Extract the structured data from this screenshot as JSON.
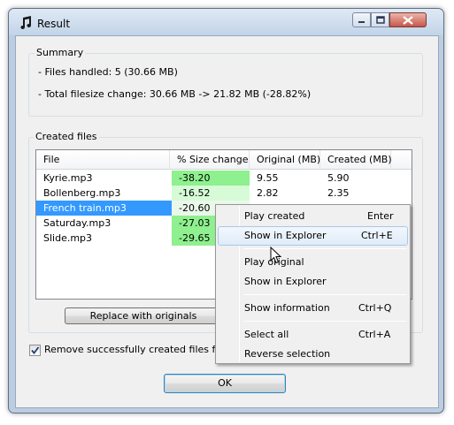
{
  "window": {
    "title": "Result"
  },
  "summary": {
    "legend": "Summary",
    "files_handled": "- Files handled: 5  (30.66 MB)",
    "total_change": "- Total filesize change: 30.66 MB -> 21.82 MB  (-28.82%)"
  },
  "created_files": {
    "legend": "Created files",
    "columns": [
      "File",
      "% Size change",
      "Original  (MB)",
      "Created  (MB)"
    ],
    "rows": [
      {
        "file": "Kyrie.mp3",
        "change": "-38.20",
        "original": "9.55",
        "created": "5.90"
      },
      {
        "file": "Bollenberg.mp3",
        "change": "-16.52",
        "original": "2.82",
        "created": "2.35"
      },
      {
        "file": "French train.mp3",
        "change": "-20.60",
        "original": "",
        "created": ""
      },
      {
        "file": "Saturday.mp3",
        "change": "-27.03",
        "original": "",
        "created": ""
      },
      {
        "file": "Slide.mp3",
        "change": "-29.65",
        "original": "",
        "created": ""
      }
    ],
    "selected_row": 2
  },
  "buttons": {
    "replace": "Replace with originals",
    "ok": "OK"
  },
  "options": {
    "remove_checkbox_label": "Remove successfully created files from m",
    "remove_checked": true
  },
  "context_menu": {
    "items": [
      {
        "label": "Play created",
        "shortcut": "Enter"
      },
      {
        "label": "Show in Explorer",
        "shortcut": "Ctrl+E"
      },
      {
        "label": "Play original",
        "shortcut": ""
      },
      {
        "label": "Show in Explorer",
        "shortcut": ""
      },
      {
        "label": "Show information",
        "shortcut": "Ctrl+Q"
      },
      {
        "label": "Select all",
        "shortcut": "Ctrl+A"
      },
      {
        "label": "Reverse selection",
        "shortcut": ""
      }
    ],
    "hovered_index": 1
  },
  "colors": {
    "selection": "#3399ff",
    "strong_reduction": "#8ef08e",
    "light_reduction": "#d6fbd6",
    "selected_change_bg": "#eaf8ea"
  }
}
